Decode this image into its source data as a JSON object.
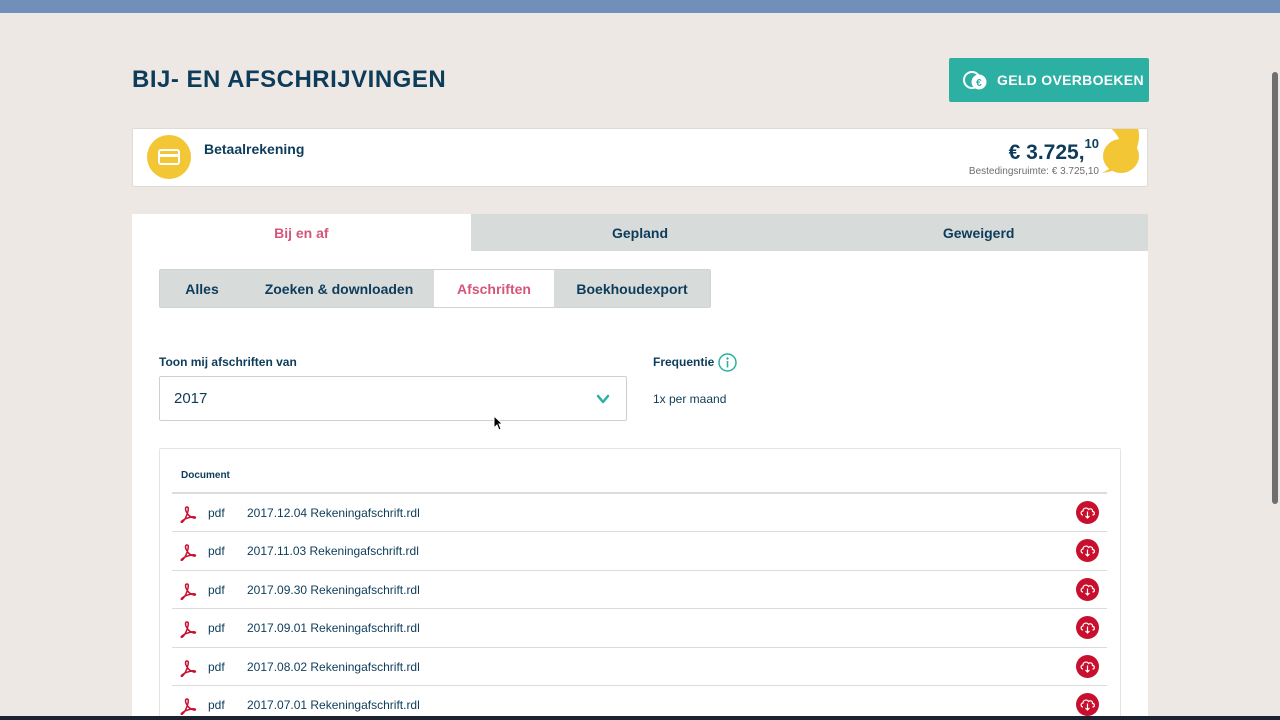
{
  "header": {
    "title": "BIJ- EN AFSCHRIJVINGEN",
    "transfer_button": "GELD OVERBOEKEN"
  },
  "account": {
    "name": "Betaalrekening",
    "balance_main": "€ 3.725,",
    "balance_cents": "10",
    "spending_room": "Bestedingsruimte: € 3.725,10"
  },
  "tabs": [
    {
      "label": "Bij en af",
      "active": true
    },
    {
      "label": "Gepland",
      "active": false
    },
    {
      "label": "Geweigerd",
      "active": false
    }
  ],
  "subtabs": [
    {
      "label": "Alles",
      "active": false
    },
    {
      "label": "Zoeken & downloaden",
      "active": false
    },
    {
      "label": "Afschriften",
      "active": true
    },
    {
      "label": "Boekhoudexport",
      "active": false
    }
  ],
  "filter": {
    "show_label": "Toon mij afschriften van",
    "selected_year": "2017",
    "frequency_label": "Frequentie",
    "frequency_value": "1x per maand"
  },
  "documents": {
    "header": "Document",
    "rows": [
      {
        "type": "pdf",
        "name": "2017.12.04 Rekeningafschrift.rdl"
      },
      {
        "type": "pdf",
        "name": "2017.11.03 Rekeningafschrift.rdl"
      },
      {
        "type": "pdf",
        "name": "2017.09.30 Rekeningafschrift.rdl"
      },
      {
        "type": "pdf",
        "name": "2017.09.01 Rekeningafschrift.rdl"
      },
      {
        "type": "pdf",
        "name": "2017.08.02 Rekeningafschrift.rdl"
      },
      {
        "type": "pdf",
        "name": "2017.07.01 Rekeningafschrift.rdl"
      }
    ]
  },
  "colors": {
    "navy": "#0d3c5a",
    "teal": "#2bb0a3",
    "pink": "#d5567a",
    "yellow": "#f2c635",
    "download_red": "#c8102e",
    "background": "#ede8e4"
  },
  "icons": {
    "transfer": "euro-transfer-icon",
    "account": "credit-card-icon",
    "select": "chevron-down-icon",
    "info": "info-icon",
    "document": "pdf-icon",
    "download": "cloud-download-icon"
  }
}
